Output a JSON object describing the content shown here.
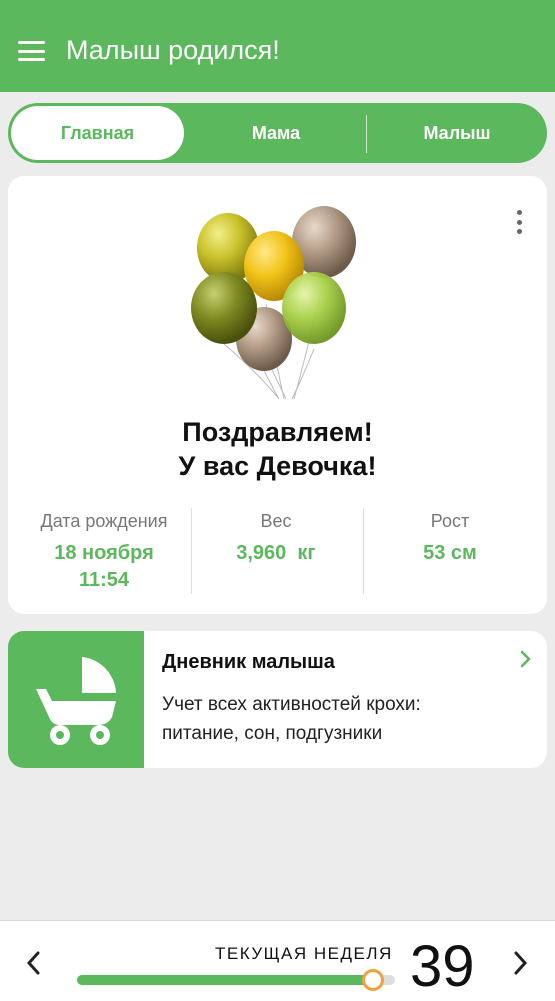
{
  "appbar": {
    "title": "Малыш родился!",
    "menu_icon": "menu-icon"
  },
  "tabs": [
    {
      "label": "Главная",
      "active": true
    },
    {
      "label": "Мама",
      "active": false
    },
    {
      "label": "Малыш",
      "active": false
    }
  ],
  "birth_card": {
    "congrats_line1": "Поздравляем!",
    "congrats_line2": "У вас Девочка!",
    "stats": {
      "birth_date": {
        "label": "Дата рождения",
        "value_line1": "18 ноября",
        "value_line2": "11:54"
      },
      "weight": {
        "label": "Вес",
        "value": "3,960  кг"
      },
      "height": {
        "label": "Рост",
        "value": "53 см"
      }
    }
  },
  "diary": {
    "title": "Дневник малыша",
    "description": "Учет всех активностей крохи: питание, сон, подгузники",
    "icon": "baby-stroller-icon"
  },
  "week_bar": {
    "label": "ТЕКУЩАЯ НЕДЕЛЯ",
    "week": "39",
    "progress": 0.93
  },
  "colors": {
    "accent": "#5cb85c",
    "knob": "#f0a040"
  }
}
